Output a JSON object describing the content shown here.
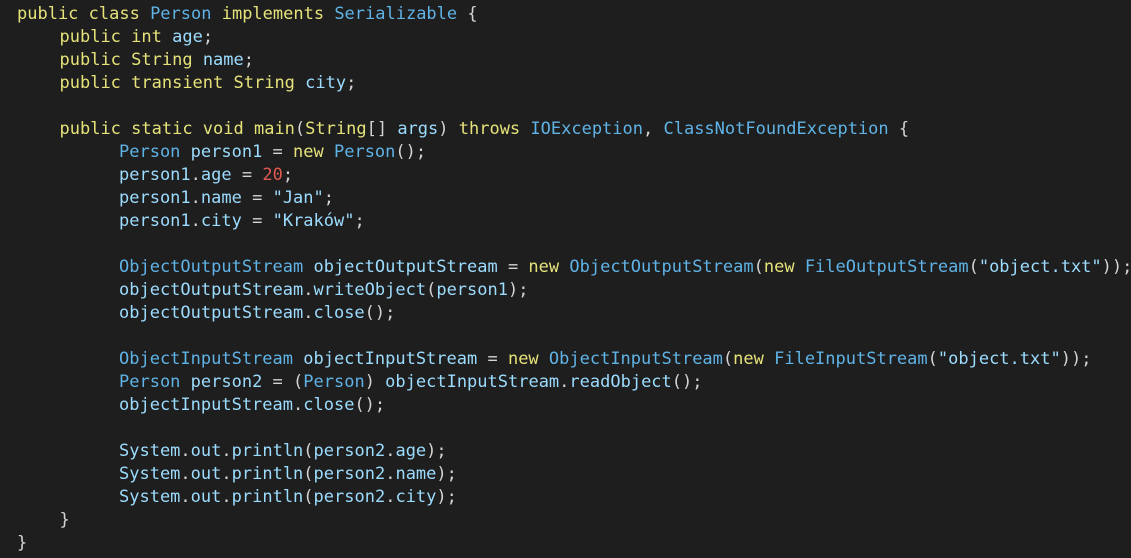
{
  "editor": {
    "lines": [
      {
        "indent": 2,
        "tokens": [
          {
            "t": "public class ",
            "k": "kw"
          },
          {
            "t": "Person",
            "k": "type"
          },
          {
            "t": " implements ",
            "k": "kw"
          },
          {
            "t": "Serializable",
            "k": "type"
          },
          {
            "t": " {",
            "k": "punc"
          }
        ]
      },
      {
        "indent": 7,
        "tokens": [
          {
            "t": "public ",
            "k": "kw"
          },
          {
            "t": "int ",
            "k": "kw"
          },
          {
            "t": "age",
            "k": "var"
          },
          {
            "t": ";",
            "k": "punc"
          }
        ]
      },
      {
        "indent": 7,
        "tokens": [
          {
            "t": "public ",
            "k": "kw"
          },
          {
            "t": "String ",
            "k": "kw"
          },
          {
            "t": "name",
            "k": "var"
          },
          {
            "t": ";",
            "k": "punc"
          }
        ]
      },
      {
        "indent": 7,
        "tokens": [
          {
            "t": "public transient ",
            "k": "kw"
          },
          {
            "t": "String ",
            "k": "kw"
          },
          {
            "t": "city",
            "k": "var"
          },
          {
            "t": ";",
            "k": "punc"
          }
        ]
      },
      {
        "indent": 0,
        "tokens": []
      },
      {
        "indent": 7,
        "tokens": [
          {
            "t": "public static void ",
            "k": "kw"
          },
          {
            "t": "main",
            "k": "kw"
          },
          {
            "t": "(",
            "k": "punc"
          },
          {
            "t": "String",
            "k": "kw"
          },
          {
            "t": "[] ",
            "k": "punc"
          },
          {
            "t": "args",
            "k": "var"
          },
          {
            "t": ") ",
            "k": "punc"
          },
          {
            "t": "throws ",
            "k": "kw"
          },
          {
            "t": "IOException",
            "k": "type"
          },
          {
            "t": ", ",
            "k": "punc"
          },
          {
            "t": "ClassNotFoundException",
            "k": "type"
          },
          {
            "t": " {",
            "k": "punc"
          }
        ]
      },
      {
        "indent": 14,
        "tokens": [
          {
            "t": "Person ",
            "k": "type"
          },
          {
            "t": "person1",
            "k": "var"
          },
          {
            "t": " = ",
            "k": "punc"
          },
          {
            "t": "new ",
            "k": "kw"
          },
          {
            "t": "Person",
            "k": "type"
          },
          {
            "t": "();",
            "k": "punc"
          }
        ]
      },
      {
        "indent": 14,
        "tokens": [
          {
            "t": "person1",
            "k": "var"
          },
          {
            "t": ".",
            "k": "punc"
          },
          {
            "t": "age",
            "k": "var"
          },
          {
            "t": " = ",
            "k": "punc"
          },
          {
            "t": "20",
            "k": "num"
          },
          {
            "t": ";",
            "k": "punc"
          }
        ]
      },
      {
        "indent": 14,
        "tokens": [
          {
            "t": "person1",
            "k": "var"
          },
          {
            "t": ".",
            "k": "punc"
          },
          {
            "t": "name",
            "k": "var"
          },
          {
            "t": " = ",
            "k": "punc"
          },
          {
            "t": "\"Jan\"",
            "k": "str"
          },
          {
            "t": ";",
            "k": "punc"
          }
        ]
      },
      {
        "indent": 14,
        "tokens": [
          {
            "t": "person1",
            "k": "var"
          },
          {
            "t": ".",
            "k": "punc"
          },
          {
            "t": "city",
            "k": "var"
          },
          {
            "t": " = ",
            "k": "punc"
          },
          {
            "t": "\"Kraków\"",
            "k": "str"
          },
          {
            "t": ";",
            "k": "punc"
          }
        ]
      },
      {
        "indent": 0,
        "tokens": []
      },
      {
        "indent": 14,
        "tokens": [
          {
            "t": "ObjectOutputStream ",
            "k": "type"
          },
          {
            "t": "objectOutputStream",
            "k": "var"
          },
          {
            "t": " = ",
            "k": "punc"
          },
          {
            "t": "new ",
            "k": "kw"
          },
          {
            "t": "ObjectOutputStream",
            "k": "type"
          },
          {
            "t": "(",
            "k": "punc"
          },
          {
            "t": "new ",
            "k": "kw"
          },
          {
            "t": "FileOutputStream",
            "k": "type"
          },
          {
            "t": "(",
            "k": "punc"
          },
          {
            "t": "\"object.txt\"",
            "k": "str"
          },
          {
            "t": "));",
            "k": "punc"
          }
        ]
      },
      {
        "indent": 14,
        "tokens": [
          {
            "t": "objectOutputStream",
            "k": "var"
          },
          {
            "t": ".",
            "k": "punc"
          },
          {
            "t": "writeObject",
            "k": "var"
          },
          {
            "t": "(",
            "k": "punc"
          },
          {
            "t": "person1",
            "k": "var"
          },
          {
            "t": ");",
            "k": "punc"
          }
        ]
      },
      {
        "indent": 14,
        "tokens": [
          {
            "t": "objectOutputStream",
            "k": "var"
          },
          {
            "t": ".",
            "k": "punc"
          },
          {
            "t": "close",
            "k": "var"
          },
          {
            "t": "();",
            "k": "punc"
          }
        ]
      },
      {
        "indent": 0,
        "tokens": []
      },
      {
        "indent": 14,
        "tokens": [
          {
            "t": "ObjectInputStream ",
            "k": "type"
          },
          {
            "t": "objectInputStream",
            "k": "var"
          },
          {
            "t": " = ",
            "k": "punc"
          },
          {
            "t": "new ",
            "k": "kw"
          },
          {
            "t": "ObjectInputStream",
            "k": "type"
          },
          {
            "t": "(",
            "k": "punc"
          },
          {
            "t": "new ",
            "k": "kw"
          },
          {
            "t": "FileInputStream",
            "k": "type"
          },
          {
            "t": "(",
            "k": "punc"
          },
          {
            "t": "\"object.txt\"",
            "k": "str"
          },
          {
            "t": "));",
            "k": "punc"
          }
        ]
      },
      {
        "indent": 14,
        "tokens": [
          {
            "t": "Person ",
            "k": "type"
          },
          {
            "t": "person2",
            "k": "var"
          },
          {
            "t": " = (",
            "k": "punc"
          },
          {
            "t": "Person",
            "k": "type"
          },
          {
            "t": ") ",
            "k": "punc"
          },
          {
            "t": "objectInputStream",
            "k": "var"
          },
          {
            "t": ".",
            "k": "punc"
          },
          {
            "t": "readObject",
            "k": "var"
          },
          {
            "t": "();",
            "k": "punc"
          }
        ]
      },
      {
        "indent": 14,
        "tokens": [
          {
            "t": "objectInputStream",
            "k": "var"
          },
          {
            "t": ".",
            "k": "punc"
          },
          {
            "t": "close",
            "k": "var"
          },
          {
            "t": "();",
            "k": "punc"
          }
        ]
      },
      {
        "indent": 0,
        "tokens": []
      },
      {
        "indent": 14,
        "tokens": [
          {
            "t": "System",
            "k": "var"
          },
          {
            "t": ".",
            "k": "punc"
          },
          {
            "t": "out",
            "k": "var"
          },
          {
            "t": ".",
            "k": "punc"
          },
          {
            "t": "println",
            "k": "var"
          },
          {
            "t": "(",
            "k": "punc"
          },
          {
            "t": "person2",
            "k": "var"
          },
          {
            "t": ".",
            "k": "punc"
          },
          {
            "t": "age",
            "k": "var"
          },
          {
            "t": ");",
            "k": "punc"
          }
        ]
      },
      {
        "indent": 14,
        "tokens": [
          {
            "t": "System",
            "k": "var"
          },
          {
            "t": ".",
            "k": "punc"
          },
          {
            "t": "out",
            "k": "var"
          },
          {
            "t": ".",
            "k": "punc"
          },
          {
            "t": "println",
            "k": "var"
          },
          {
            "t": "(",
            "k": "punc"
          },
          {
            "t": "person2",
            "k": "var"
          },
          {
            "t": ".",
            "k": "punc"
          },
          {
            "t": "name",
            "k": "var"
          },
          {
            "t": ");",
            "k": "punc"
          }
        ]
      },
      {
        "indent": 14,
        "tokens": [
          {
            "t": "System",
            "k": "var"
          },
          {
            "t": ".",
            "k": "punc"
          },
          {
            "t": "out",
            "k": "var"
          },
          {
            "t": ".",
            "k": "punc"
          },
          {
            "t": "println",
            "k": "var"
          },
          {
            "t": "(",
            "k": "punc"
          },
          {
            "t": "person2",
            "k": "var"
          },
          {
            "t": ".",
            "k": "punc"
          },
          {
            "t": "city",
            "k": "var"
          },
          {
            "t": ");",
            "k": "punc"
          }
        ]
      },
      {
        "indent": 7,
        "tokens": [
          {
            "t": "}",
            "k": "punc"
          }
        ]
      },
      {
        "indent": 2,
        "tokens": [
          {
            "t": "}",
            "k": "punc"
          }
        ]
      }
    ]
  },
  "colors": {
    "background": "#1e1e1e",
    "keyword": "#e6e27a",
    "type": "#5fb3e6",
    "variable": "#9cdcfe",
    "number": "#e0584f",
    "punctuation": "#d4d4d4"
  }
}
